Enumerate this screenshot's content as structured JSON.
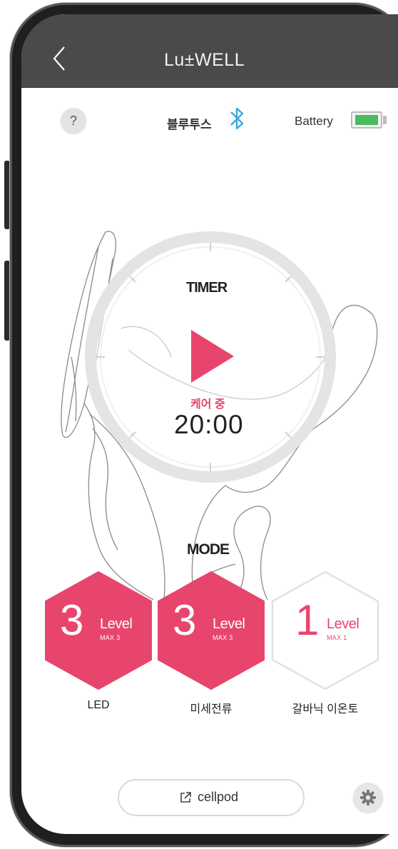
{
  "header": {
    "title": "Lu±WELL",
    "back_icon": "chevron-left-icon"
  },
  "status": {
    "help_label": "?",
    "bluetooth_label": "블루투스",
    "bluetooth_icon": "bluetooth-icon",
    "battery_label": "Battery",
    "battery_level": 0.9,
    "battery_color": "#4cbb5b"
  },
  "timer": {
    "title": "TIMER",
    "status_text": "케어 중",
    "time": "20:00",
    "play_icon": "play-icon",
    "accent_color": "#e8456d"
  },
  "mode": {
    "title": "MODE",
    "items": [
      {
        "value": "3",
        "level_label": "Level",
        "max_label": "MAX 3",
        "name": "LED",
        "style": "filled"
      },
      {
        "value": "3",
        "level_label": "Level",
        "max_label": "MAX 3",
        "name": "미세전류",
        "style": "filled"
      },
      {
        "value": "1",
        "level_label": "Level",
        "max_label": "MAX 1",
        "name": "갈바닉 이온토",
        "style": "outline"
      }
    ]
  },
  "footer": {
    "cellpod_label": "cellpod",
    "link_icon": "external-link-icon",
    "settings_icon": "gear-icon"
  }
}
